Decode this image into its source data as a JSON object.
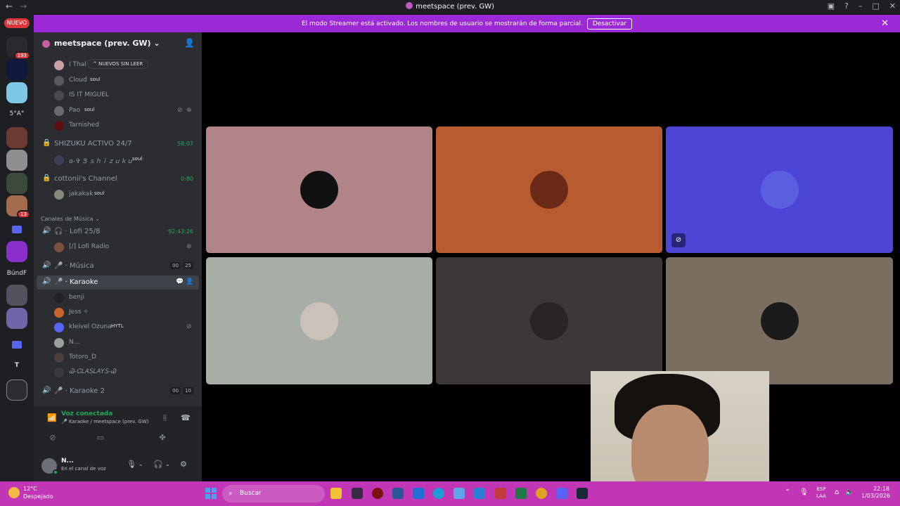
{
  "window": {
    "title": "meetspace (prev. GW)"
  },
  "banner": {
    "text": "El modo Streamer está activado. Los nombres de usuario se mostrarán de forma parcial.",
    "button": "Desactivar"
  },
  "rail": {
    "new_label": "NUEVO",
    "badges": [
      "193",
      "13"
    ],
    "labels": [
      "5°A°",
      "BúndF",
      "T"
    ]
  },
  "server": {
    "name": "meetspace (prev. GW)"
  },
  "unread_pill": "NUEVOS SIN LEER",
  "channel_users_top": [
    {
      "name": "I Thal",
      "tag": ""
    },
    {
      "name": "Cloud",
      "tag": "soul"
    },
    {
      "name": "IS IT MIGUEL",
      "tag": ""
    },
    {
      "name": "Pao",
      "tag": "soul"
    },
    {
      "name": "Tarnished",
      "tag": ""
    }
  ],
  "channels": {
    "shizuku": {
      "name": "SHIZUKU ACTIVO 24/7",
      "time": "58:07",
      "user": "ɞ-✞ Ꮥ ｓｈｉｚｕｋｕ ˙˙˙",
      "user_tag": "soul"
    },
    "cottonii": {
      "name": "cottonii's Channel",
      "time": "0:80",
      "user": "jakakak",
      "user_tag": "soul"
    },
    "music_category": "Canales de Música",
    "lofi": {
      "name": "Lofi 25/8",
      "time": "92:43:26",
      "user": "[/] Lofi Radio"
    },
    "musica": {
      "name": "Música",
      "count_a": "00",
      "count_b": "25"
    },
    "karaoke": {
      "name": "Karaoke"
    },
    "karaoke_users": [
      {
        "name": "benji",
        "tag": ""
      },
      {
        "name": "Jess ✧",
        "tag": ""
      },
      {
        "name": "kleivel Ozuna",
        "tag": "HYTL"
      },
      {
        "name": "N...",
        "tag": ""
      },
      {
        "name": "Totoro_D",
        "tag": ""
      },
      {
        "name": "Ꮚ-ᏟᏞᎪᏚᏞᎪYᏚ-Ꮚ",
        "tag": ""
      }
    ],
    "karaoke2": {
      "name": "Karaoke 2",
      "count_a": "00",
      "count_b": "10"
    }
  },
  "voice": {
    "status": "Voz conectada",
    "location": "Karaoke / meetspace (prev. GW)"
  },
  "user": {
    "name": "N...",
    "status": "En el canal de voz"
  },
  "tiles_colors": [
    "#b08488",
    "#b95b30",
    "#4c45d6",
    "#a9ada7",
    "#3c3838",
    "#7a6e60"
  ],
  "taskbar": {
    "temp": "12°C",
    "condition": "Despejado",
    "search": "Buscar",
    "lang_top": "ESP",
    "lang_bottom": "LAA",
    "time": "22:18",
    "date": "1/03/2026"
  }
}
